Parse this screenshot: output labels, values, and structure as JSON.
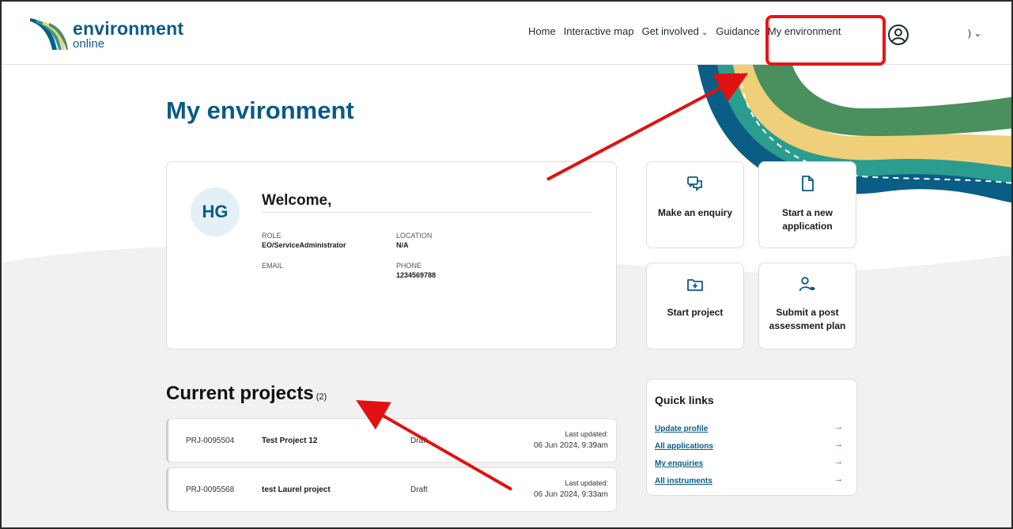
{
  "brand": {
    "name": "environment",
    "sub": "online"
  },
  "nav": {
    "items": [
      {
        "label": "Home",
        "dropdown": false
      },
      {
        "label": "Interactive map",
        "dropdown": false
      },
      {
        "label": "Get involved",
        "dropdown": true
      },
      {
        "label": "Guidance",
        "dropdown": false
      },
      {
        "label": "My environment",
        "dropdown": false
      }
    ],
    "user_menu_label": ") ⌄"
  },
  "page": {
    "title": "My environment"
  },
  "profile": {
    "initials": "HG",
    "welcome": "Welcome,",
    "role_label": "ROLE",
    "role_value": "EO/ServiceAdministrator",
    "location_label": "LOCATION",
    "location_value": "N/A",
    "email_label": "EMAIL",
    "phone_label": "PHONE",
    "phone_value": "1234569788"
  },
  "actions": [
    {
      "label": "Make an enquiry",
      "icon": "chat-icon"
    },
    {
      "label": "Start a new application",
      "icon": "document-icon"
    },
    {
      "label": "Start project",
      "icon": "folder-plus-icon"
    },
    {
      "label": "Submit a post assessment plan",
      "icon": "user-tag-icon"
    }
  ],
  "projects": {
    "title": "Current projects",
    "count": "(2)",
    "rows": [
      {
        "id": "PRJ-0095504",
        "name": "Test Project 12",
        "status": "Draft",
        "updated_label": "Last updated:",
        "updated": "06 Jun 2024, 9:39am"
      },
      {
        "id": "PRJ-0095568",
        "name": "test Laurel project",
        "status": "Draft",
        "updated_label": "Last updated:",
        "updated": "06 Jun 2024, 9:33am"
      }
    ]
  },
  "quick_links": {
    "title": "Quick links",
    "items": [
      "Update profile",
      "All applications",
      "My enquiries",
      "All instruments"
    ],
    "arrow": "→"
  },
  "colors": {
    "brand_blue": "#0b5a86",
    "wave_green": "#4a8f5e",
    "wave_teal": "#2a9d8f",
    "wave_yellow": "#efcf7a",
    "wave_navy": "#0a5e86",
    "annotation_red": "#e11111"
  }
}
